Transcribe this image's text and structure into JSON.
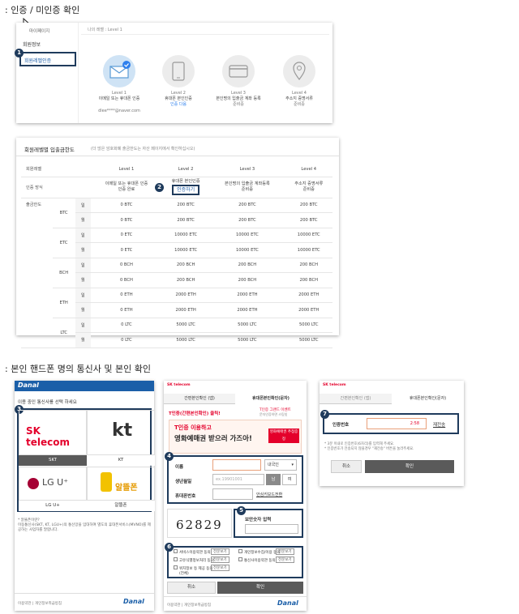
{
  "section1_title": ": 인증 / 미인증 확인",
  "section2_title": ": 본인 핸드폰 명의 통신사 및 본인 확인",
  "mypage": {
    "nav_top": "마이페이지",
    "nav_items": [
      "회원정보",
      "회원레벨인증"
    ],
    "breadcrumb": "나의 레벨 : Level 1",
    "levels": [
      {
        "name": "Level 1",
        "desc": "이메일 또는 휴대폰 인증",
        "status": "",
        "extra": "dlee****@naver.com"
      },
      {
        "name": "Level 2",
        "desc": "휴대폰 본인인증",
        "status": "인증 다음",
        "extra": ""
      },
      {
        "name": "Level 3",
        "desc": "본인명의 입출금 계좌 등록",
        "status": "준비중",
        "extra": ""
      },
      {
        "name": "Level 4",
        "desc": "주소지 증명서류",
        "status": "준비중",
        "extra": ""
      }
    ]
  },
  "limits": {
    "title": "회원레벨별 입출금한도",
    "subtitle": "(더 많은 암호화폐 출금한도는 자산 페이지에서 확인하십시오)",
    "header_label": "회원레벨",
    "levels": [
      "Level 1",
      "Level 2",
      "Level 3",
      "Level 4"
    ],
    "auth_label": "인증 방식",
    "auth_methods": [
      "이메일 또는 휴대폰 인증\n인증 완료",
      "휴대폰 본인인증",
      "본인명의 입출금 계좌등록\n준비중",
      "주소지 증명서류\n준비중"
    ],
    "auth_button": "인증하기",
    "withdraw_label": "출금한도",
    "day_label": "일",
    "month_label": "월",
    "coins": [
      {
        "coin": "BTC",
        "day": [
          "0 BTC",
          "200 BTC",
          "200 BTC",
          "200 BTC"
        ],
        "month": [
          "0 BTC",
          "200 BTC",
          "200 BTC",
          "200 BTC"
        ]
      },
      {
        "coin": "ETC",
        "day": [
          "0 ETC",
          "10000 ETC",
          "10000 ETC",
          "10000 ETC"
        ],
        "month": [
          "0 ETC",
          "10000 ETC",
          "10000 ETC",
          "10000 ETC"
        ]
      },
      {
        "coin": "BCH",
        "day": [
          "0 BCH",
          "200 BCH",
          "200 BCH",
          "200 BCH"
        ],
        "month": [
          "0 BCH",
          "200 BCH",
          "200 BCH",
          "200 BCH"
        ]
      },
      {
        "coin": "ETH",
        "day": [
          "0 ETH",
          "2000 ETH",
          "2000 ETH",
          "2000 ETH"
        ],
        "month": [
          "0 ETH",
          "2000 ETH",
          "2000 ETH",
          "2000 ETH"
        ]
      },
      {
        "coin": "LTC",
        "day": [
          "0 LTC",
          "5000 LTC",
          "5000 LTC",
          "5000 LTC"
        ],
        "month": [
          "0 LTC",
          "5000 LTC",
          "5000 LTC",
          "5000 LTC"
        ]
      }
    ]
  },
  "danal1": {
    "brand": "Danal",
    "instruction": "이용 중인 통신사를 선택 하세요",
    "carriers": [
      {
        "label": "SKT",
        "logo": "SK telecom"
      },
      {
        "label": "KT",
        "logo": "kt"
      },
      {
        "label": "LG U+",
        "logo": "LG U⁺"
      },
      {
        "label": "알뜰폰",
        "logo": "알뜰폰"
      }
    ],
    "notes": "* 알뜰폰이란?\n이동통신사(SKT, KT, LGU+)의 통신망을 임대하여 별도의 휴대폰서비스(MVNO)를 제공하는 사업자를 말합니다.",
    "footer": "이용약관 | 개인정보취급방침",
    "footer_brand": "Danal"
  },
  "danal2": {
    "brand": "SK telecom",
    "tab_app": "간편본인확인 (앱)",
    "tab_sms": "휴대폰본인확인(문자)",
    "promo_top": "T인증(간편본인확인) 클릭!",
    "promo_event": "T인증 그랜드 이벤트",
    "promo_sub": "문자인증하면 스팀잇",
    "banner_line1": "T인증 이용하고",
    "banner_line2": "영화예매권 받으러 가즈아!",
    "banner_badge": "영화예매권 추첨증정",
    "name_label": "이름",
    "nation": "내국인",
    "birth_label": "생년월일",
    "birth_placeholder": "ex.19901001",
    "gender_m": "남",
    "gender_f": "여",
    "phone_label": "휴대폰번호",
    "phone_link": "안심키보드전환",
    "captcha": "62829",
    "captcha_label": "보안숫자 입력",
    "agreements": [
      "서비스이용약관 동의",
      "개인정보수집/이용 동의",
      "고유식별정보처리 동의",
      "통신사이용약관 동의",
      "위치정보 등 제공 동의"
    ],
    "agree_all": "(전체)",
    "view_label": "전문보기",
    "cancel": "취소",
    "confirm": "확인",
    "footer": "이용약관 | 개인정보취급방침",
    "footer_brand": "Danal"
  },
  "danal3": {
    "brand": "SK telecom",
    "tab_app": "간편본인확인 (앱)",
    "tab_sms": "휴대폰본인확인(문자)",
    "code_label": "인증번호",
    "timer": "2:58",
    "resend": "재전송",
    "notes": "* 3분 이내로 인증번호(6자리)를 입력해 주세요.\n* 인증번호가 전송되지 않을경우 \"재전송\" 버튼을 눌러주세요.",
    "cancel": "취소",
    "confirm": "확인"
  },
  "markers": [
    "1",
    "2",
    "3",
    "4",
    "5",
    "6",
    "7"
  ],
  "colors": {
    "accent": "#1f3b5c",
    "danal": "#1b5fa8",
    "sk_red": "#e4002b",
    "kt_gray": "#5b5b5b",
    "lg_red": "#a50034",
    "primary_red": "#e4002b"
  }
}
